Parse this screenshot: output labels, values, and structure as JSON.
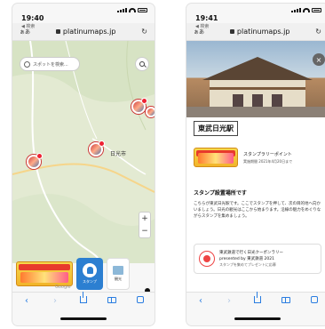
{
  "left": {
    "status": {
      "time": "19:40",
      "back": "◀ 検索"
    },
    "url": {
      "aa": "ぁあ",
      "host": "platinumaps.jp"
    },
    "map": {
      "search_placeholder": "スポットを検索...",
      "place_label": "日光市",
      "zoom_in": "+",
      "zoom_out": "−",
      "stamp_label": "スタンプ",
      "map_card_label": "観光",
      "watermark": "Google"
    }
  },
  "right": {
    "status": {
      "time": "19:41",
      "back": "◀ 検索"
    },
    "url": {
      "aa": "ぁあ",
      "host": "platinumaps.jp"
    },
    "detail": {
      "station": "東武日光駅",
      "stamp_title": "スタンプラリーポイント",
      "stamp_date": "実施期間 2021年4月20日まで",
      "section_title": "スタンプ設置場所です",
      "section_body": "こちらが東武日光駅です。ここでスタンプを押して、次の目的地へ向かいましょう。日光の観光はここから始まります。沿線の魅力をめぐりながらスタンプを集めましょう。",
      "partner_line1": "東武鉄道で行く日光クーポンラリー",
      "partner_line2": "presented by 東武鉄道 2021",
      "partner_line3": "スタンプを集めてプレゼントに応募"
    },
    "close": "×"
  },
  "toolbar": {
    "back": "‹",
    "forward": "›"
  }
}
